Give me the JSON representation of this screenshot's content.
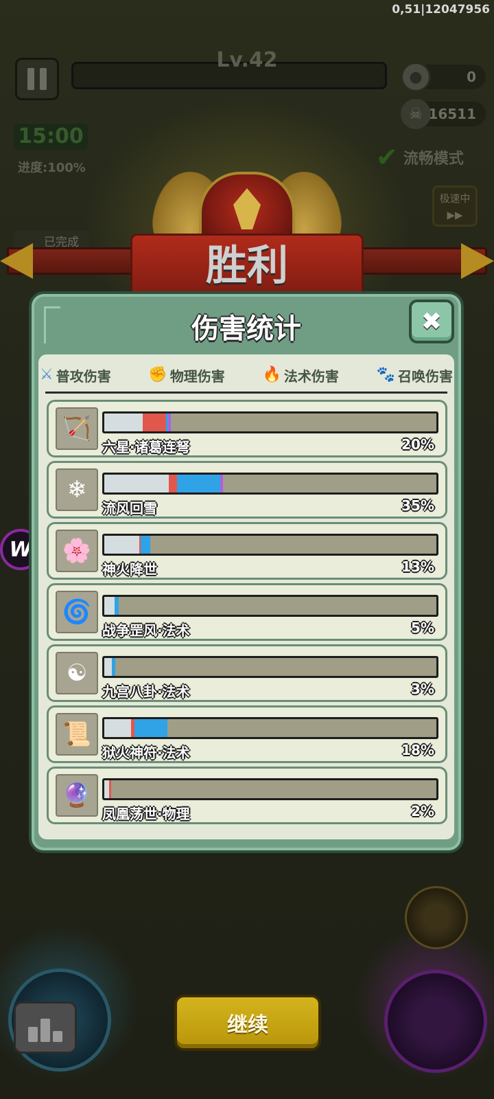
{
  "hud": {
    "debug_info": "0,51|12047956",
    "level": "Lv.42",
    "coins": "0",
    "kills": "16511",
    "timer": "15:00",
    "progress": "进度:100%",
    "smooth_mode": "流畅模式",
    "speed_label": "极速中",
    "speed_glyph": "▶▶",
    "done_tag": "已完成"
  },
  "banner": {
    "title": "胜利"
  },
  "panel": {
    "title": "伤害统计",
    "close_glyph": "✖",
    "tabs": [
      {
        "label": "普攻伤害",
        "icon": "sword-icon",
        "glyph": "⚔",
        "color": "#4a8fd8"
      },
      {
        "label": "物理伤害",
        "icon": "fist-icon",
        "glyph": "✊",
        "color": "#d22b22"
      },
      {
        "label": "法术伤害",
        "icon": "flame-icon",
        "glyph": "🔥",
        "color": "#2a86e0"
      },
      {
        "label": "召唤伤害",
        "icon": "paw-icon",
        "glyph": "🐾",
        "color": "#9b3fc7"
      }
    ],
    "segment_colors": {
      "light": "#d5dde0",
      "physical": "#e2574c",
      "spell": "#2fa3e6",
      "summon": "#b05ee0"
    },
    "items": [
      {
        "name": "六星·诸葛连弩",
        "percent": "20%",
        "icon": "crossbow-icon",
        "glyph": "🏹",
        "segments": {
          "light": 0.115,
          "physical": 0.07,
          "spell": 0.008,
          "summon": 0.008
        }
      },
      {
        "name": "流风回雪",
        "percent": "35%",
        "icon": "ice-staff-icon",
        "glyph": "❄",
        "segments": {
          "light": 0.195,
          "physical": 0.025,
          "spell": 0.13,
          "summon": 0.008
        }
      },
      {
        "name": "神火降世",
        "percent": "13%",
        "icon": "fire-lotus-icon",
        "glyph": "🌸",
        "segments": {
          "light": 0.105,
          "physical": 0.004,
          "spell": 0.03,
          "summon": 0
        }
      },
      {
        "name": "战争罡风·法术",
        "percent": "5%",
        "icon": "whirlwind-icon",
        "glyph": "🌀",
        "segments": {
          "light": 0.032,
          "physical": 0,
          "spell": 0.012,
          "summon": 0
        }
      },
      {
        "name": "九宫八卦·法术",
        "percent": "3%",
        "icon": "bagua-icon",
        "glyph": "☯",
        "segments": {
          "light": 0.022,
          "physical": 0,
          "spell": 0.012,
          "summon": 0
        }
      },
      {
        "name": "狱火神符·法术",
        "percent": "18%",
        "icon": "talisman-icon",
        "glyph": "📜",
        "segments": {
          "light": 0.08,
          "physical": 0.01,
          "spell": 0.1,
          "summon": 0
        }
      },
      {
        "name": "凤凰荡世·物理",
        "percent": "2%",
        "icon": "phoenix-icon",
        "glyph": "🔮",
        "segments": {
          "light": 0.015,
          "physical": 0.006,
          "spell": 0,
          "summon": 0
        }
      }
    ]
  },
  "continue_label": "继续",
  "side_logo": "W"
}
